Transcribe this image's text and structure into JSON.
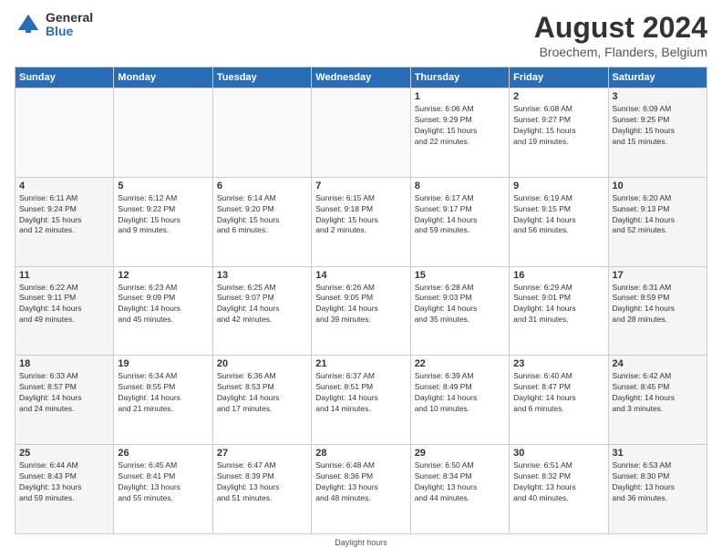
{
  "header": {
    "logo_general": "General",
    "logo_blue": "Blue",
    "month_title": "August 2024",
    "location": "Broechem, Flanders, Belgium"
  },
  "days_of_week": [
    "Sunday",
    "Monday",
    "Tuesday",
    "Wednesday",
    "Thursday",
    "Friday",
    "Saturday"
  ],
  "footer_text": "Daylight hours",
  "weeks": [
    [
      {
        "day": "",
        "info": ""
      },
      {
        "day": "",
        "info": ""
      },
      {
        "day": "",
        "info": ""
      },
      {
        "day": "",
        "info": ""
      },
      {
        "day": "1",
        "info": "Sunrise: 6:06 AM\nSunset: 9:29 PM\nDaylight: 15 hours\nand 22 minutes."
      },
      {
        "day": "2",
        "info": "Sunrise: 6:08 AM\nSunset: 9:27 PM\nDaylight: 15 hours\nand 19 minutes."
      },
      {
        "day": "3",
        "info": "Sunrise: 6:09 AM\nSunset: 9:25 PM\nDaylight: 15 hours\nand 15 minutes."
      }
    ],
    [
      {
        "day": "4",
        "info": "Sunrise: 6:11 AM\nSunset: 9:24 PM\nDaylight: 15 hours\nand 12 minutes."
      },
      {
        "day": "5",
        "info": "Sunrise: 6:12 AM\nSunset: 9:22 PM\nDaylight: 15 hours\nand 9 minutes."
      },
      {
        "day": "6",
        "info": "Sunrise: 6:14 AM\nSunset: 9:20 PM\nDaylight: 15 hours\nand 6 minutes."
      },
      {
        "day": "7",
        "info": "Sunrise: 6:15 AM\nSunset: 9:18 PM\nDaylight: 15 hours\nand 2 minutes."
      },
      {
        "day": "8",
        "info": "Sunrise: 6:17 AM\nSunset: 9:17 PM\nDaylight: 14 hours\nand 59 minutes."
      },
      {
        "day": "9",
        "info": "Sunrise: 6:19 AM\nSunset: 9:15 PM\nDaylight: 14 hours\nand 56 minutes."
      },
      {
        "day": "10",
        "info": "Sunrise: 6:20 AM\nSunset: 9:13 PM\nDaylight: 14 hours\nand 52 minutes."
      }
    ],
    [
      {
        "day": "11",
        "info": "Sunrise: 6:22 AM\nSunset: 9:11 PM\nDaylight: 14 hours\nand 49 minutes."
      },
      {
        "day": "12",
        "info": "Sunrise: 6:23 AM\nSunset: 9:09 PM\nDaylight: 14 hours\nand 45 minutes."
      },
      {
        "day": "13",
        "info": "Sunrise: 6:25 AM\nSunset: 9:07 PM\nDaylight: 14 hours\nand 42 minutes."
      },
      {
        "day": "14",
        "info": "Sunrise: 6:26 AM\nSunset: 9:05 PM\nDaylight: 14 hours\nand 39 minutes."
      },
      {
        "day": "15",
        "info": "Sunrise: 6:28 AM\nSunset: 9:03 PM\nDaylight: 14 hours\nand 35 minutes."
      },
      {
        "day": "16",
        "info": "Sunrise: 6:29 AM\nSunset: 9:01 PM\nDaylight: 14 hours\nand 31 minutes."
      },
      {
        "day": "17",
        "info": "Sunrise: 6:31 AM\nSunset: 8:59 PM\nDaylight: 14 hours\nand 28 minutes."
      }
    ],
    [
      {
        "day": "18",
        "info": "Sunrise: 6:33 AM\nSunset: 8:57 PM\nDaylight: 14 hours\nand 24 minutes."
      },
      {
        "day": "19",
        "info": "Sunrise: 6:34 AM\nSunset: 8:55 PM\nDaylight: 14 hours\nand 21 minutes."
      },
      {
        "day": "20",
        "info": "Sunrise: 6:36 AM\nSunset: 8:53 PM\nDaylight: 14 hours\nand 17 minutes."
      },
      {
        "day": "21",
        "info": "Sunrise: 6:37 AM\nSunset: 8:51 PM\nDaylight: 14 hours\nand 14 minutes."
      },
      {
        "day": "22",
        "info": "Sunrise: 6:39 AM\nSunset: 8:49 PM\nDaylight: 14 hours\nand 10 minutes."
      },
      {
        "day": "23",
        "info": "Sunrise: 6:40 AM\nSunset: 8:47 PM\nDaylight: 14 hours\nand 6 minutes."
      },
      {
        "day": "24",
        "info": "Sunrise: 6:42 AM\nSunset: 8:45 PM\nDaylight: 14 hours\nand 3 minutes."
      }
    ],
    [
      {
        "day": "25",
        "info": "Sunrise: 6:44 AM\nSunset: 8:43 PM\nDaylight: 13 hours\nand 59 minutes."
      },
      {
        "day": "26",
        "info": "Sunrise: 6:45 AM\nSunset: 8:41 PM\nDaylight: 13 hours\nand 55 minutes."
      },
      {
        "day": "27",
        "info": "Sunrise: 6:47 AM\nSunset: 8:39 PM\nDaylight: 13 hours\nand 51 minutes."
      },
      {
        "day": "28",
        "info": "Sunrise: 6:48 AM\nSunset: 8:36 PM\nDaylight: 13 hours\nand 48 minutes."
      },
      {
        "day": "29",
        "info": "Sunrise: 6:50 AM\nSunset: 8:34 PM\nDaylight: 13 hours\nand 44 minutes."
      },
      {
        "day": "30",
        "info": "Sunrise: 6:51 AM\nSunset: 8:32 PM\nDaylight: 13 hours\nand 40 minutes."
      },
      {
        "day": "31",
        "info": "Sunrise: 6:53 AM\nSunset: 8:30 PM\nDaylight: 13 hours\nand 36 minutes."
      }
    ]
  ]
}
